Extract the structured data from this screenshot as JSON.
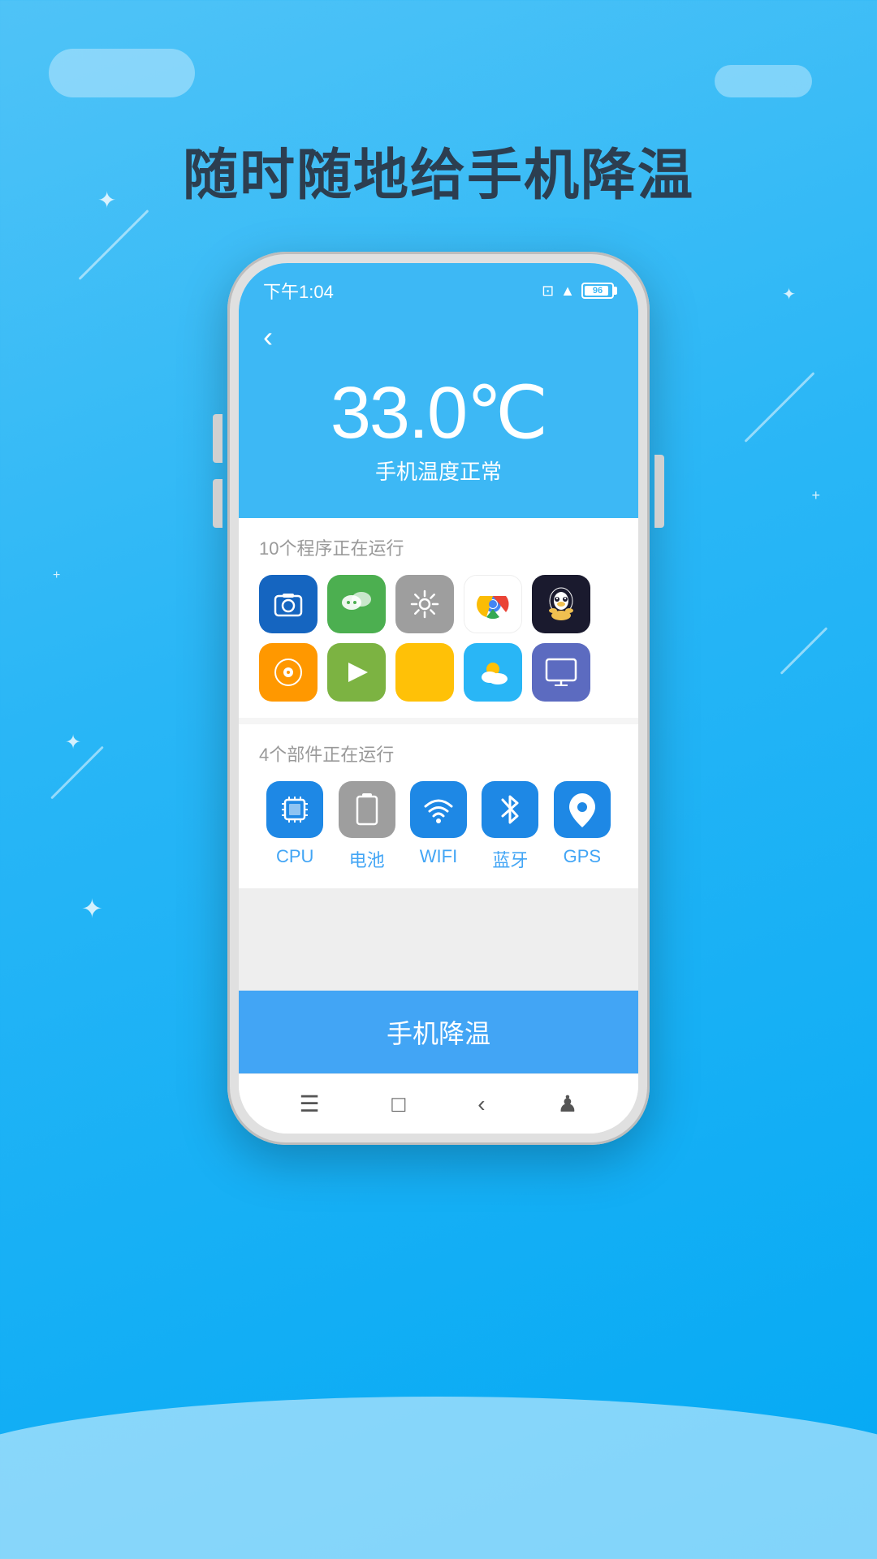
{
  "page": {
    "title": "随时随地给手机降温",
    "background_color": "#29b6f6"
  },
  "status_bar": {
    "time": "下午1:04",
    "battery_level": "96"
  },
  "app": {
    "back_button": "‹",
    "temperature": "33.0℃",
    "temperature_status": "手机温度正常",
    "running_programs_label": "10个程序正在运行",
    "running_components_label": "4个部件正在运行",
    "cool_button_label": "手机降温"
  },
  "components": [
    {
      "name": "CPU",
      "icon": "⊞",
      "color": "blue"
    },
    {
      "name": "电池",
      "icon": "▯",
      "color": "gray"
    },
    {
      "name": "WIFI",
      "icon": "((·))",
      "color": "blue"
    },
    {
      "name": "蓝牙",
      "icon": "✱",
      "color": "blue"
    },
    {
      "name": "GPS",
      "icon": "◉",
      "color": "blue"
    }
  ],
  "apps": [
    {
      "icon": "📷",
      "color": "#1565c0"
    },
    {
      "icon": "💬",
      "color": "#4CAF50"
    },
    {
      "icon": "⚙",
      "color": "#9e9e9e"
    },
    {
      "icon": "◎",
      "color": "#white"
    },
    {
      "icon": "🐧",
      "color": "#212121"
    },
    {
      "icon": "🎵",
      "color": "#FF9800"
    },
    {
      "icon": "◄",
      "color": "#8BC34A"
    },
    {
      "icon": "◑",
      "color": "#FFC107"
    },
    {
      "icon": "🌤",
      "color": "#29b6f6"
    },
    {
      "icon": "🖥",
      "color": "#673ab7"
    }
  ]
}
